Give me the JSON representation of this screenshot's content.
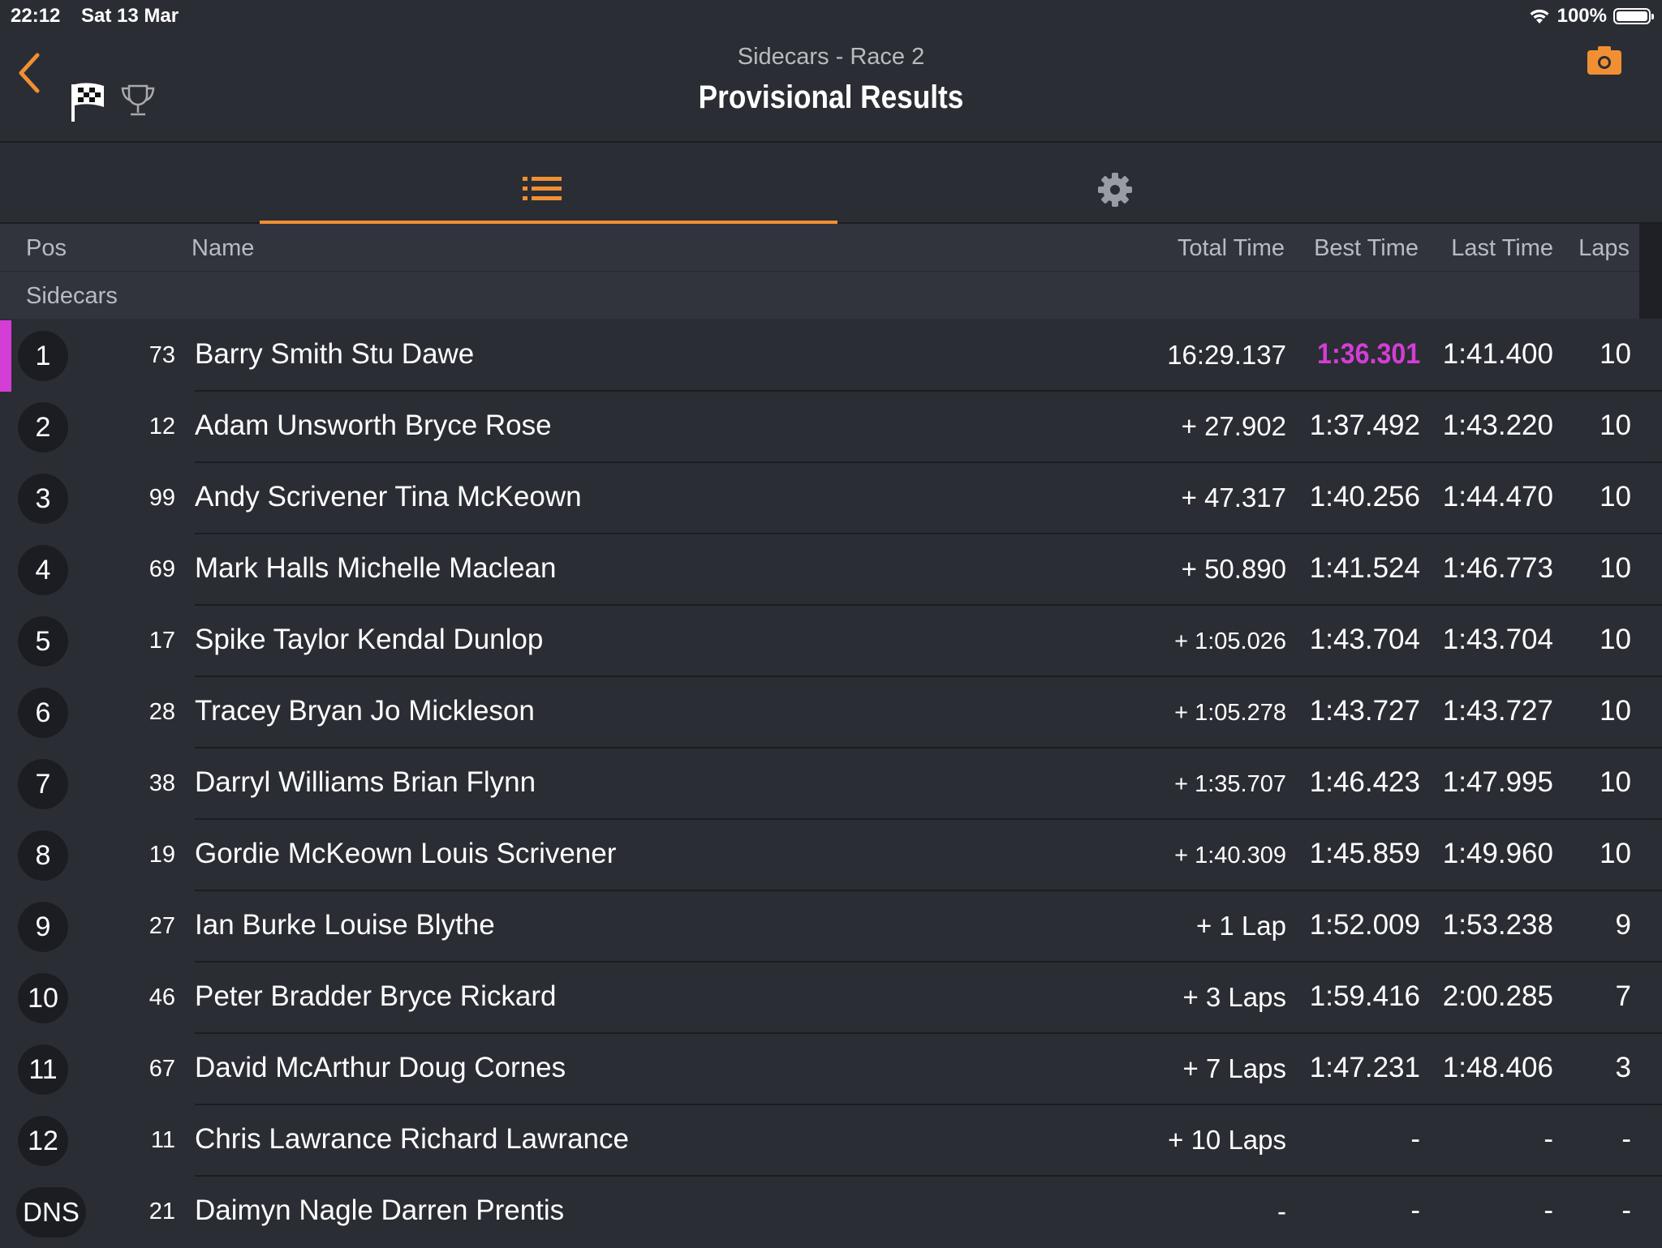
{
  "status": {
    "time": "22:12",
    "date": "Sat 13 Mar",
    "battery": "100%"
  },
  "header": {
    "subtitle": "Sidecars - Race 2",
    "title": "Provisional Results"
  },
  "accent_color": "#f09033",
  "fastest_color": "#d43dd6",
  "columns": {
    "pos": "Pos",
    "name": "Name",
    "total": "Total Time",
    "best": "Best Time",
    "last": "Last Time",
    "laps": "Laps"
  },
  "group": "Sidecars",
  "rows": [
    {
      "pos": "1",
      "num": "73",
      "name": "Barry Smith Stu Dawe",
      "total": "16:29.137",
      "best": "1:36.301",
      "last": "1:41.400",
      "laps": "10"
    },
    {
      "pos": "2",
      "num": "12",
      "name": "Adam Unsworth Bryce Rose",
      "total": "+ 27.902",
      "best": "1:37.492",
      "last": "1:43.220",
      "laps": "10"
    },
    {
      "pos": "3",
      "num": "99",
      "name": "Andy Scrivener Tina McKeown",
      "total": "+ 47.317",
      "best": "1:40.256",
      "last": "1:44.470",
      "laps": "10"
    },
    {
      "pos": "4",
      "num": "69",
      "name": "Mark Halls Michelle Maclean",
      "total": "+ 50.890",
      "best": "1:41.524",
      "last": "1:46.773",
      "laps": "10"
    },
    {
      "pos": "5",
      "num": "17",
      "name": "Spike Taylor Kendal Dunlop",
      "total": "+ 1:05.026",
      "best": "1:43.704",
      "last": "1:43.704",
      "laps": "10"
    },
    {
      "pos": "6",
      "num": "28",
      "name": "Tracey Bryan Jo Mickleson",
      "total": "+ 1:05.278",
      "best": "1:43.727",
      "last": "1:43.727",
      "laps": "10"
    },
    {
      "pos": "7",
      "num": "38",
      "name": "Darryl Williams Brian Flynn",
      "total": "+ 1:35.707",
      "best": "1:46.423",
      "last": "1:47.995",
      "laps": "10"
    },
    {
      "pos": "8",
      "num": "19",
      "name": "Gordie McKeown Louis Scrivener",
      "total": "+ 1:40.309",
      "best": "1:45.859",
      "last": "1:49.960",
      "laps": "10"
    },
    {
      "pos": "9",
      "num": "27",
      "name": "Ian Burke Louise Blythe",
      "total": "+ 1 Lap",
      "best": "1:52.009",
      "last": "1:53.238",
      "laps": "9"
    },
    {
      "pos": "10",
      "num": "46",
      "name": "Peter Bradder Bryce Rickard",
      "total": "+ 3 Laps",
      "best": "1:59.416",
      "last": "2:00.285",
      "laps": "7"
    },
    {
      "pos": "11",
      "num": "67",
      "name": "David McArthur Doug Cornes",
      "total": "+ 7 Laps",
      "best": "1:47.231",
      "last": "1:48.406",
      "laps": "3"
    },
    {
      "pos": "12",
      "num": "11",
      "name": "Chris Lawrance Richard Lawrance",
      "total": "+ 10 Laps",
      "best": "-",
      "last": "-",
      "laps": "-"
    },
    {
      "pos": "DNS",
      "num": "21",
      "name": "Daimyn Nagle Darren Prentis",
      "total": "-",
      "best": "-",
      "last": "-",
      "laps": "-"
    }
  ]
}
